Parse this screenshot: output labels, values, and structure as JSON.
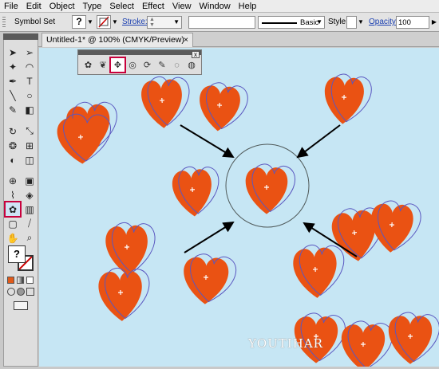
{
  "menu": [
    "File",
    "Edit",
    "Object",
    "Type",
    "Select",
    "Effect",
    "View",
    "Window",
    "Help"
  ],
  "control_bar": {
    "selection_label": "Symbol Set",
    "stroke_label": "Stroke:",
    "brush_label": "Basic",
    "style_label": "Style:",
    "opacity_label": "Opacity:",
    "opacity_value": "100"
  },
  "document": {
    "tab_title": "Untitled-1* @ 100% (CMYK/Preview)",
    "close_glyph": "×"
  },
  "symbols_panel": {
    "close_glyph": "x",
    "tools": [
      "symbol-sprayer",
      "symbol-shifter",
      "symbol-scruncher",
      "symbol-sizer",
      "symbol-spinner",
      "symbol-stainer",
      "symbol-screener",
      "symbol-styler"
    ],
    "selected_tool": "symbol-scruncher"
  },
  "toolbox": {
    "selected_tool": "symbol-sprayer",
    "help_glyph": "?"
  },
  "canvas": {
    "background": "#c6e6f4",
    "heart_color": "#ea5213",
    "outline_color": "#5a57c0",
    "watermark": "YOUTIHAR"
  }
}
